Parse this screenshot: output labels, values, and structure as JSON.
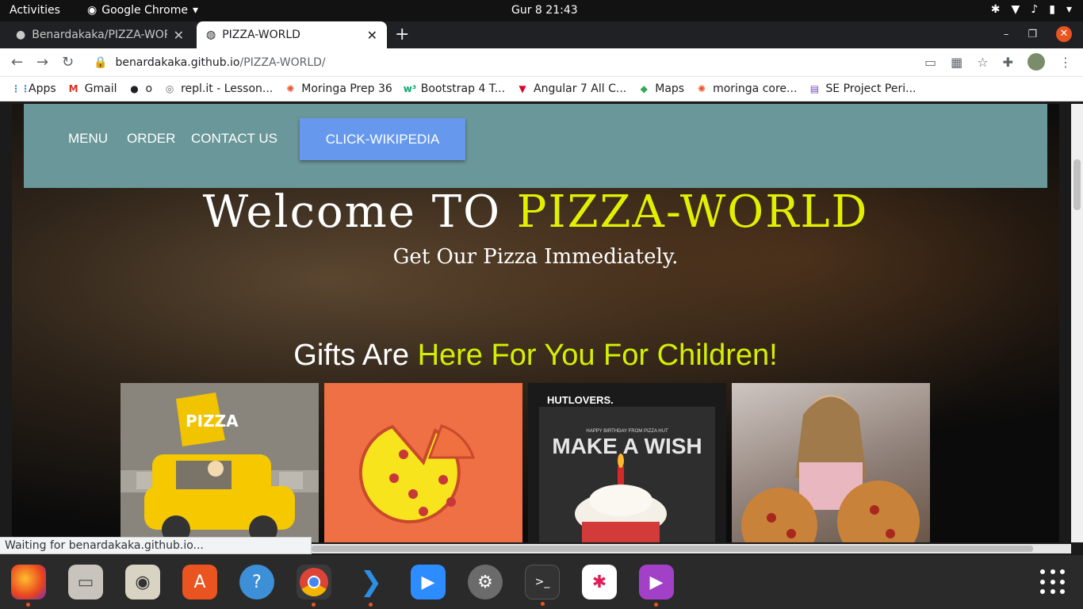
{
  "os_topbar": {
    "activities": "Activities",
    "app_name": "Google Chrome",
    "clock": "Gur 8  21:43"
  },
  "browser": {
    "tabs": [
      {
        "title": "Benardakaka/PIZZA-WOR",
        "active": false
      },
      {
        "title": "PIZZA-WORLD",
        "active": true
      }
    ],
    "url_host": "benardakaka.github.io",
    "url_path": "/PIZZA-WORLD/",
    "bookmarks": [
      {
        "label": "Apps",
        "icon": "apps-grid-icon"
      },
      {
        "label": "Gmail",
        "icon": "gmail-icon"
      },
      {
        "label": "o",
        "icon": "github-icon"
      },
      {
        "label": "repl.it - Lesson...",
        "icon": "replit-icon"
      },
      {
        "label": "Moringa Prep 36",
        "icon": "moringa-icon"
      },
      {
        "label": "Bootstrap 4 T...",
        "icon": "w3schools-icon"
      },
      {
        "label": "Angular 7 All C...",
        "icon": "angular-icon"
      },
      {
        "label": "Maps",
        "icon": "maps-icon"
      },
      {
        "label": "moringa core...",
        "icon": "moringa-icon"
      },
      {
        "label": "SE Project Peri...",
        "icon": "forms-icon"
      }
    ],
    "status_text": "Waiting for benardakaka.github.io..."
  },
  "page": {
    "nav": {
      "menu": "MENU",
      "order": "ORDER",
      "contact": "CONTACT US",
      "wiki_button": "CLICK-WIKIPEDIA"
    },
    "hero": {
      "title_prefix": "Welcome TO ",
      "title_highlight": "PIZZA-WORLD",
      "subtitle": "Get Our Pizza Immediately."
    },
    "gifts": {
      "title_prefix": "Gifts Are ",
      "title_highlight": "Here For You For Children!",
      "card3_brand": "HUTLOVERS.",
      "card3_small": "HAPPY BIRTHDAY FROM PIZZA HUT",
      "card3_headline": "MAKE A WISH"
    }
  },
  "colors": {
    "navbar": "#6a9799",
    "wiki_button": "#6699ee",
    "highlight": "#e2f000"
  }
}
